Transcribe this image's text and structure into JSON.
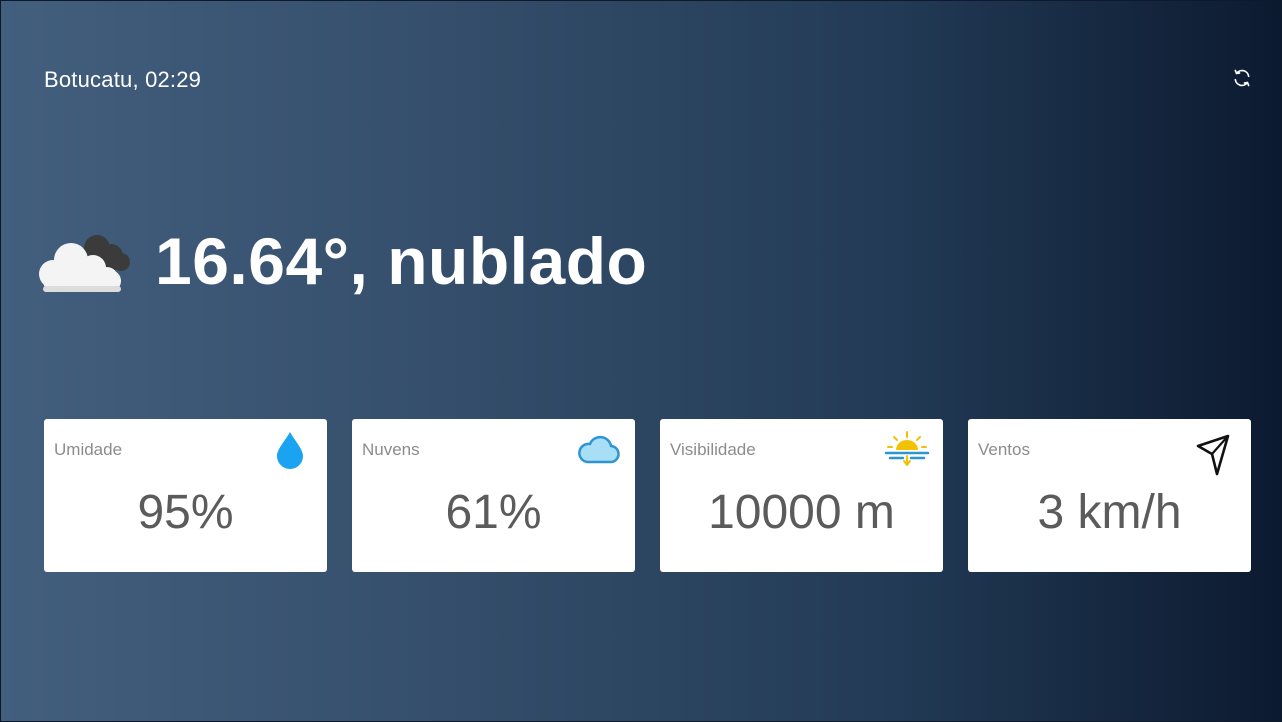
{
  "header": {
    "location_time": "Botucatu, 02:29",
    "refresh_icon": "refresh-icon"
  },
  "current": {
    "summary": "16.64°, nublado",
    "icon": "cloudy-icon"
  },
  "cards": [
    {
      "label": "Umidade",
      "value": "95%",
      "icon": "water-drop-icon",
      "icon_color": "#1aa3f0"
    },
    {
      "label": "Nuvens",
      "value": "61%",
      "icon": "cloud-icon",
      "icon_color": "#2b96cf"
    },
    {
      "label": "Visibilidade",
      "value": "10000 m",
      "icon": "sunset-icon",
      "icon_color": "#f2c200"
    },
    {
      "label": "Ventos",
      "value": "3 km/h",
      "icon": "navigation-arrow-icon",
      "icon_color": "#111111"
    }
  ]
}
